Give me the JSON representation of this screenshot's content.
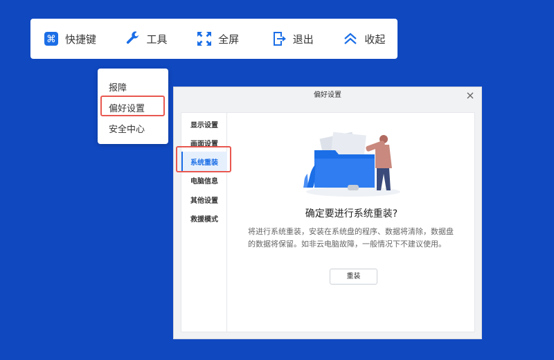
{
  "toolbar": {
    "items": [
      {
        "label": "快捷键",
        "icon": "command-icon"
      },
      {
        "label": "工具",
        "icon": "wrench-icon"
      },
      {
        "label": "全屏",
        "icon": "fullscreen-icon"
      },
      {
        "label": "退出",
        "icon": "exit-icon"
      },
      {
        "label": "收起",
        "icon": "collapse-icon"
      }
    ]
  },
  "dropdown": {
    "items": [
      "报障",
      "偏好设置",
      "安全中心"
    ]
  },
  "dialog": {
    "title": "偏好设置",
    "sidebar": [
      "显示设置",
      "画面设置",
      "系统重装",
      "电脑信息",
      "其他设置",
      "救援模式"
    ],
    "active_item": "系统重装",
    "heading": "确定要进行系统重装?",
    "description": "将进行系统重装，安装在系统盘的程序、数据将清除，数据盘的数据将保留。如非云电脑故障，一般情况下不建议使用。",
    "button": "重装"
  },
  "colors": {
    "background": "#1048c0",
    "accent": "#1b6ee6",
    "highlight": "#e8574f"
  }
}
